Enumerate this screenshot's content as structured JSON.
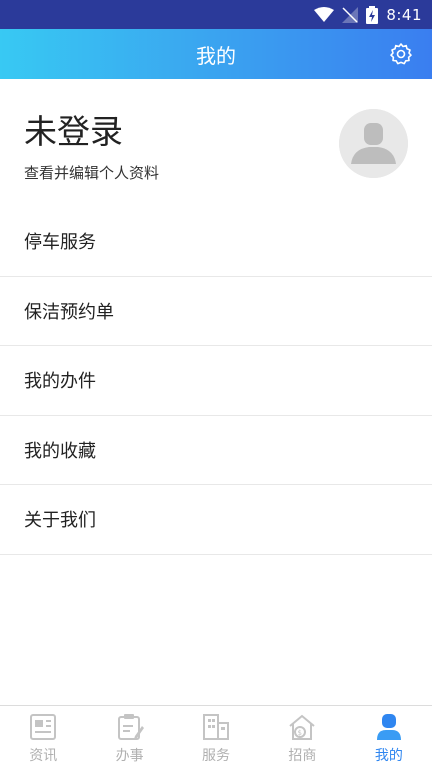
{
  "status_bar": {
    "time": "8:41"
  },
  "header": {
    "title": "我的"
  },
  "profile": {
    "name": "未登录",
    "subtitle": "查看并编辑个人资料"
  },
  "menu": {
    "items": [
      {
        "label": "停车服务"
      },
      {
        "label": "保洁预约单"
      },
      {
        "label": "我的办件"
      },
      {
        "label": "我的收藏"
      },
      {
        "label": "关于我们"
      }
    ]
  },
  "tabs": [
    {
      "label": "资讯",
      "icon": "news-icon",
      "active": false
    },
    {
      "label": "办事",
      "icon": "task-icon",
      "active": false
    },
    {
      "label": "服务",
      "icon": "building-icon",
      "active": false
    },
    {
      "label": "招商",
      "icon": "investment-icon",
      "active": false
    },
    {
      "label": "我的",
      "icon": "profile-icon",
      "active": true
    }
  ],
  "colors": {
    "accent": "#2f86f0",
    "status_bar": "#2b3a9a",
    "inactive": "#b0b0b0"
  }
}
